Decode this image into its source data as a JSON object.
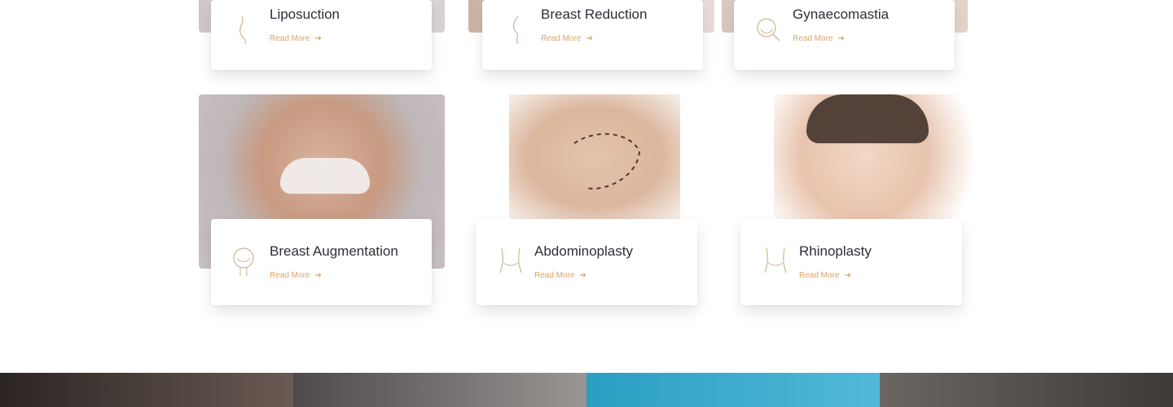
{
  "cards": [
    {
      "title": "Liposuction",
      "link": "Read More",
      "icon": "body-silhouette-icon"
    },
    {
      "title": "Breast Reduction",
      "link": "Read More",
      "icon": "torso-profile-icon"
    },
    {
      "title": "Gynaecomastia",
      "link": "Read More",
      "icon": "face-magnifier-icon"
    },
    {
      "title": "Breast Augmentation",
      "link": "Read More",
      "icon": "face-outline-icon"
    },
    {
      "title": "Abdominoplasty",
      "link": "Read More",
      "icon": "waist-icon"
    },
    {
      "title": "Rhinoplasty",
      "link": "Read More",
      "icon": "waist-icon"
    }
  ],
  "colors": {
    "accent": "#d8a56a",
    "title": "#2e2e36",
    "strip": "#3a3230"
  }
}
